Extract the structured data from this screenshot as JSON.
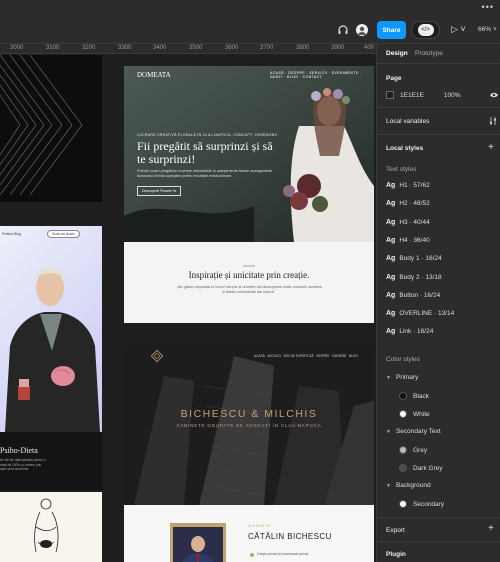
{
  "ruler": [
    "3000",
    "3100",
    "3200",
    "3300",
    "3400",
    "3500",
    "3600",
    "3700",
    "3800",
    "3900",
    "400"
  ],
  "toolbar": {
    "share_label": "Share",
    "zoom": "66%"
  },
  "panel": {
    "tabs": [
      "Design",
      "Prototype"
    ],
    "page": {
      "title": "Page",
      "color": "1E1E1E",
      "opacity": "100%"
    },
    "local_variables": "Local variables",
    "local_styles": "Local styles",
    "text_styles_title": "Text styles",
    "text_styles": [
      {
        "ag": "Ag",
        "label": "H1 · 57/62"
      },
      {
        "ag": "Ag",
        "label": "H2 · 48/52"
      },
      {
        "ag": "Ag",
        "label": "H3 · 40/44"
      },
      {
        "ag": "Ag",
        "label": "H4 · 36/40"
      },
      {
        "ag": "Ag",
        "label": "Body 1 · 16/24"
      },
      {
        "ag": "Ag",
        "label": "Body 2 · 13/18"
      },
      {
        "ag": "Ag",
        "label": "Button · 16/24"
      },
      {
        "ag": "Ag",
        "label": "OVERLINE · 13/14"
      },
      {
        "ag": "Ag",
        "label": "Link · 16/24"
      }
    ],
    "color_styles_title": "Color styles",
    "color_groups": [
      {
        "name": "Primary",
        "items": [
          {
            "name": "Black",
            "color": "#111111"
          },
          {
            "name": "White",
            "color": "#ffffff"
          }
        ]
      },
      {
        "name": "Secondary Text",
        "items": [
          {
            "name": "Grey",
            "color": "#b9b9c2"
          },
          {
            "name": "Dark Grey",
            "color": "#4a4a55"
          }
        ]
      },
      {
        "name": "Background",
        "items": [
          {
            "name": "Secondary",
            "color": "#ffffff"
          }
        ]
      }
    ],
    "export": "Export",
    "plugin": "Plugin"
  },
  "canvas": {
    "f1": {
      "logo": "DOMEATA",
      "overline": "LUCRARE CREATIVĂ FLORALĂ ÎN CLUJ-NAPOCA. CONCEPT, CEREMONII",
      "title": "Fii pregătit să surprinzi și să te surprinzi!",
      "body": "Florișrii noștri pregătesc buchete minimaliste și aranjamente florale avangardiste fuzionand tehnici speciale pentru rezultate extraordinare.",
      "button": "Descoperă Florarie Ta",
      "h2": "Inspirație și unicitate prin creație.",
      "eyebrow": "DESPRE",
      "body2": "„Ne găsim inspirația în lucruri simple și urmărim să descoperim toate modurile acestea și detalii minimaliste ale naturii.\""
    },
    "f2": {
      "nav1": "Pratica",
      "nav2": "Blog",
      "pill": "Scrie-ne acum"
    },
    "f3": {
      "title": "Psiho-Dieta",
      "body": "Un stil de viață sănătos pentru o viață de 100% cu creieru prin care să te simți bine"
    },
    "f4": {
      "nav": "ACASĂ   AVOCAȚI   ARII DE EXPERTIZĂ   DESPRE   CARIERĂ   BLOG",
      "title": "BICHESCU & MILCHIS",
      "subtitle": "CABINETE GRUPATE DE AVOCAȚI ÎN CLUJ-NAPOCA",
      "eyebrow": "ALE NOȘTRI",
      "name": "CĂTĂLIN BICHESCU",
      "item": "Drept penal și procesual penal"
    }
  }
}
